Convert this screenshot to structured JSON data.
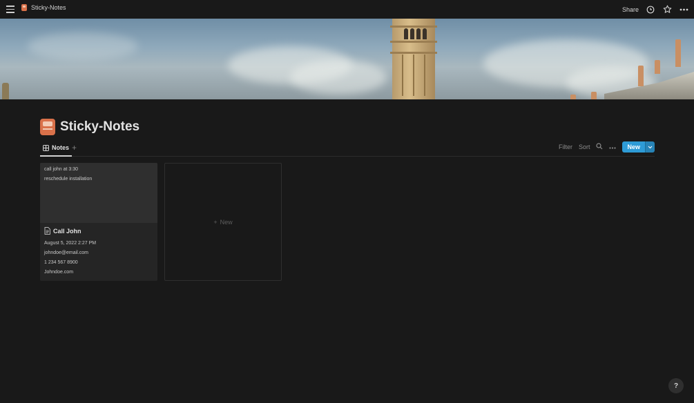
{
  "topbar": {
    "breadcrumb_title": "Sticky-Notes",
    "share_label": "Share",
    "icons": [
      "menu-icon",
      "clock-icon",
      "star-icon",
      "more-icon"
    ]
  },
  "page": {
    "title": "Sticky-Notes",
    "icon": "sticky-note-icon"
  },
  "views": {
    "tabs": [
      {
        "label": "Notes",
        "icon": "gallery-icon"
      }
    ],
    "toolbar": {
      "filter_label": "Filter",
      "sort_label": "Sort",
      "new_label": "New"
    }
  },
  "gallery": {
    "cards": [
      {
        "preview_lines": [
          "call john at 3:30",
          "reschedule installation"
        ],
        "title": "Call John",
        "date": "August 5, 2022 2:27 PM",
        "email": "johndoe@email.com",
        "phone": "1 234 567 8900",
        "website": "Johndoe.com"
      }
    ],
    "new_label": "New"
  },
  "help_label": "?",
  "colors": {
    "background": "#191919",
    "accent": "#2e9bd6",
    "page_icon": "#d9714a"
  }
}
